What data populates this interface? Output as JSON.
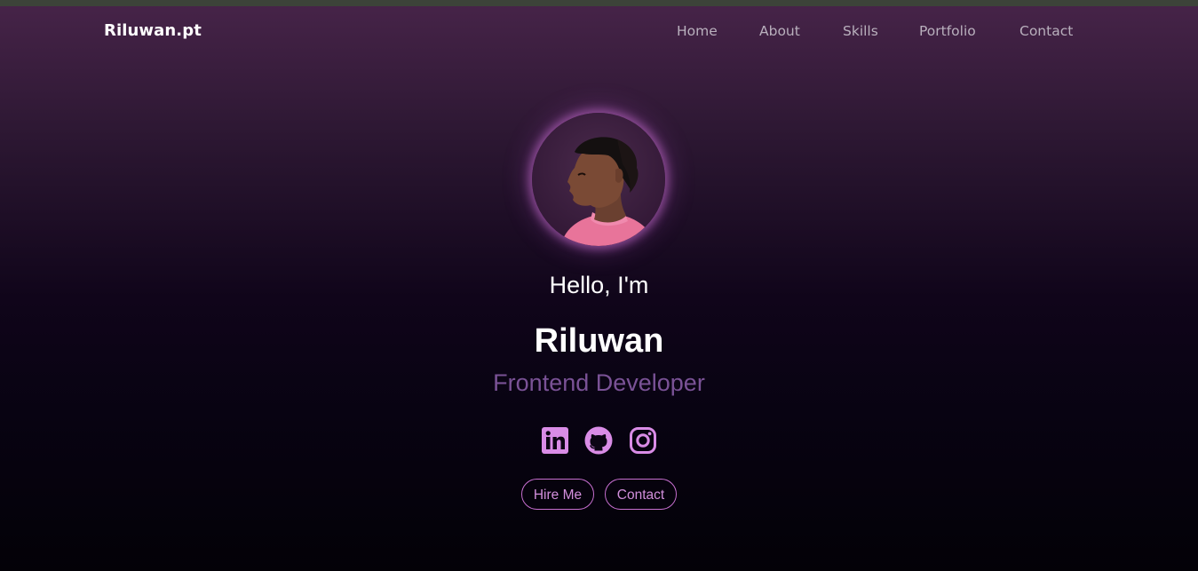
{
  "brand": "Riluwan.pt",
  "nav": {
    "items": [
      {
        "label": "Home"
      },
      {
        "label": "About"
      },
      {
        "label": "Skills"
      },
      {
        "label": "Portfolio"
      },
      {
        "label": "Contact"
      }
    ]
  },
  "hero": {
    "greeting": "Hello, I'm",
    "name": "Riluwan",
    "role": "Frontend Developer",
    "avatar_icon": "profile-photo"
  },
  "socials": [
    {
      "icon": "linkedin-icon"
    },
    {
      "icon": "github-icon"
    },
    {
      "icon": "instagram-icon"
    }
  ],
  "buttons": {
    "hire_label": "Hire Me",
    "contact_label": "Contact"
  },
  "colors": {
    "accent": "#c76fd0",
    "role_text": "#7a5296",
    "nav_text": "#b9b0bd",
    "icon": "#d98ce6"
  }
}
